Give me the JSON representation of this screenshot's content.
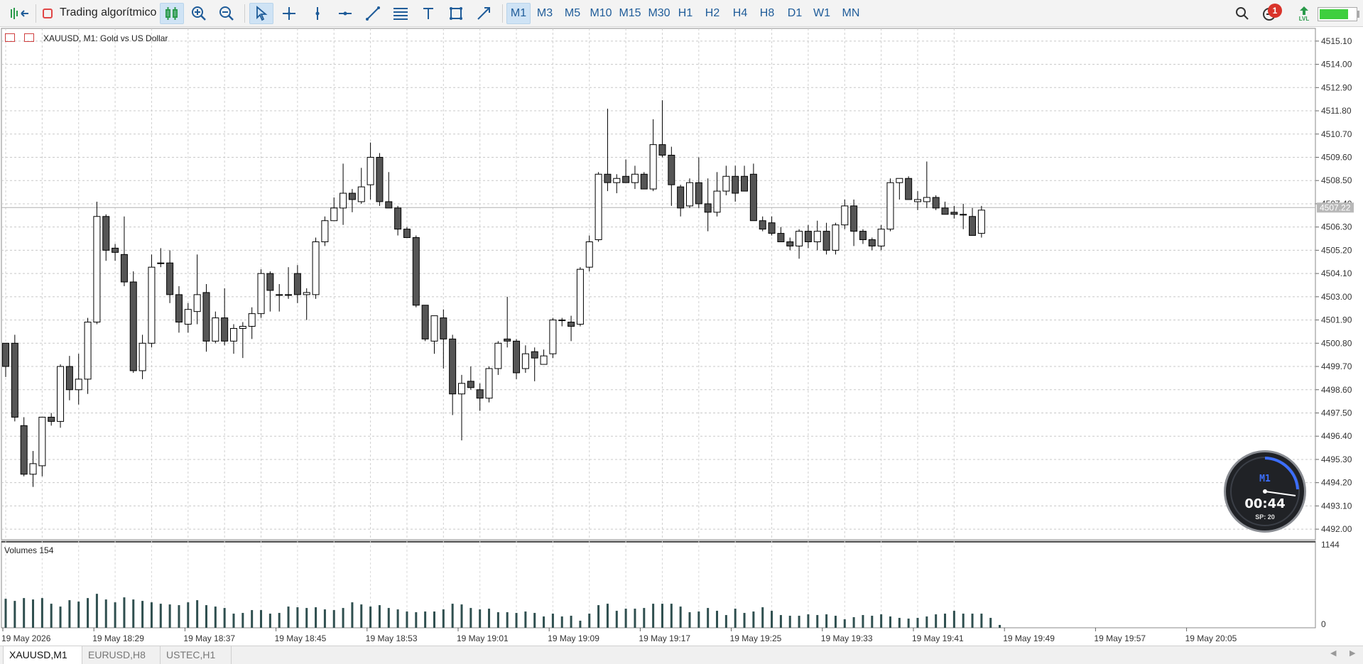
{
  "toolbar": {
    "algo_trading_label": "Trading algorítmico",
    "timeframes": [
      "M1",
      "M3",
      "M5",
      "M10",
      "M15",
      "M30",
      "H1",
      "H2",
      "H4",
      "H8",
      "D1",
      "W1",
      "MN"
    ],
    "active_timeframe": "M1",
    "notification_count": "1",
    "lvl_label": "LVL",
    "battery_level": 0.8
  },
  "chart": {
    "symbol_info": "XAUUSD, M1:  Gold vs US Dollar",
    "current_price_label": "4507.22",
    "price_labels": [
      "4515.10",
      "4514.00",
      "4512.90",
      "4511.80",
      "4510.70",
      "4509.60",
      "4508.50",
      "4507.40",
      "4506.30",
      "4505.20",
      "4504.10",
      "4503.00",
      "4501.90",
      "4500.80",
      "4499.70",
      "4498.60",
      "4497.50",
      "4496.40",
      "4495.30",
      "4494.20",
      "4493.10",
      "4492.00"
    ],
    "volume_label": "Volumes 154",
    "volume_scale_top": "1144",
    "volume_scale_bottom": "0",
    "time_labels": [
      "19 May 2026",
      "19 May 18:29",
      "19 May 18:37",
      "19 May 18:45",
      "19 May 18:53",
      "19 May 19:01",
      "19 May 19:09",
      "19 May 19:17",
      "19 May 19:25",
      "19 May 19:33",
      "19 May 19:41",
      "19 May 19:49",
      "19 May 19:57",
      "19 May 20:05"
    ]
  },
  "chart_data": {
    "type": "candlestick",
    "title": "XAUUSD, M1:  Gold vs US Dollar",
    "ylim": [
      4491.5,
      4515.7
    ],
    "candles": [
      [
        4500.8,
        4500.8,
        4499.2,
        4499.7
      ],
      [
        4500.8,
        4501.2,
        4497.1,
        4497.3
      ],
      [
        4496.9,
        4497.3,
        4494.5,
        4494.6
      ],
      [
        4494.6,
        4495.7,
        4494.0,
        4495.1
      ],
      [
        4495.0,
        4497.3,
        4494.5,
        4497.3
      ],
      [
        4497.3,
        4497.5,
        4496.9,
        4497.1
      ],
      [
        4497.1,
        4499.8,
        4496.8,
        4499.7
      ],
      [
        4499.7,
        4500.2,
        4498.1,
        4498.6
      ],
      [
        4498.6,
        4500.3,
        4497.9,
        4499.1
      ],
      [
        4499.1,
        4502.0,
        4498.4,
        4501.8
      ],
      [
        4501.8,
        4507.5,
        4501.7,
        4506.8
      ],
      [
        4506.8,
        4506.9,
        4504.7,
        4505.2
      ],
      [
        4505.3,
        4505.5,
        4504.7,
        4505.1
      ],
      [
        4505.0,
        4506.8,
        4503.5,
        4503.7
      ],
      [
        4503.7,
        4504.2,
        4499.4,
        4499.5
      ],
      [
        4499.5,
        4501.2,
        4499.1,
        4500.8
      ],
      [
        4500.8,
        4505.0,
        4500.6,
        4504.4
      ],
      [
        4504.6,
        4505.3,
        4504.4,
        4504.6
      ],
      [
        4504.6,
        4505.2,
        4502.7,
        4503.1
      ],
      [
        4503.1,
        4503.5,
        4501.3,
        4501.8
      ],
      [
        4501.7,
        4502.7,
        4501.3,
        4502.4
      ],
      [
        4502.3,
        4505.0,
        4501.7,
        4503.1
      ],
      [
        4503.2,
        4503.6,
        4500.4,
        4500.9
      ],
      [
        4500.9,
        4502.3,
        4500.8,
        4502.0
      ],
      [
        4502.0,
        4503.4,
        4500.7,
        4500.9
      ],
      [
        4500.9,
        4501.7,
        4500.3,
        4501.5
      ],
      [
        4501.5,
        4501.8,
        4500.1,
        4501.6
      ],
      [
        4501.6,
        4502.5,
        4501.0,
        4502.2
      ],
      [
        4502.2,
        4504.3,
        4502.0,
        4504.1
      ],
      [
        4504.1,
        4504.2,
        4502.3,
        4503.3
      ],
      [
        4503.1,
        4503.6,
        4502.3,
        4503.1
      ],
      [
        4503.1,
        4504.4,
        4502.9,
        4503.1
      ],
      [
        4504.1,
        4504.5,
        4502.7,
        4503.1
      ],
      [
        4503.1,
        4503.4,
        4501.9,
        4503.2
      ],
      [
        4503.1,
        4505.8,
        4502.9,
        4505.6
      ],
      [
        4505.6,
        4506.8,
        4505.4,
        4506.6
      ],
      [
        4506.6,
        4507.7,
        4506.6,
        4507.2
      ],
      [
        4507.2,
        4509.3,
        4506.4,
        4507.9
      ],
      [
        4507.9,
        4508.1,
        4507.0,
        4507.6
      ],
      [
        4507.5,
        4509.1,
        4507.4,
        4508.2
      ],
      [
        4508.3,
        4510.3,
        4507.6,
        4509.6
      ],
      [
        4509.6,
        4509.8,
        4507.3,
        4507.5
      ],
      [
        4507.5,
        4508.9,
        4507.2,
        4507.2
      ],
      [
        4507.2,
        4507.3,
        4505.9,
        4506.2
      ],
      [
        4506.2,
        4506.3,
        4505.8,
        4505.8
      ],
      [
        4505.8,
        4505.9,
        4502.5,
        4502.6
      ],
      [
        4502.6,
        4502.6,
        4500.9,
        4501.0
      ],
      [
        4500.9,
        4502.0,
        4500.3,
        4502.1
      ],
      [
        4502.0,
        4502.4,
        4499.6,
        4501.0
      ],
      [
        4501.0,
        4501.2,
        4497.4,
        4498.4
      ],
      [
        4498.4,
        4499.3,
        4496.2,
        4498.9
      ],
      [
        4499.0,
        4499.7,
        4498.6,
        4498.7
      ],
      [
        4498.6,
        4498.9,
        4497.6,
        4498.2
      ],
      [
        4498.2,
        4499.7,
        4498.0,
        4499.6
      ],
      [
        4499.6,
        4500.9,
        4499.3,
        4500.8
      ],
      [
        4501.0,
        4503.0,
        4500.6,
        4500.9
      ],
      [
        4500.9,
        4501.0,
        4499.1,
        4499.4
      ],
      [
        4499.6,
        4500.7,
        4499.4,
        4500.3
      ],
      [
        4500.4,
        4500.6,
        4499.0,
        4500.1
      ],
      [
        4499.8,
        4500.5,
        4499.8,
        4500.2
      ],
      [
        4500.3,
        4502.0,
        4500.1,
        4501.9
      ],
      [
        4501.9,
        4502.0,
        4501.6,
        4501.9
      ],
      [
        4501.8,
        4502.1,
        4500.9,
        4501.6
      ],
      [
        4501.7,
        4504.4,
        4501.6,
        4504.3
      ],
      [
        4504.4,
        4505.9,
        4504.2,
        4505.6
      ],
      [
        4505.7,
        4508.9,
        4505.6,
        4508.8
      ],
      [
        4508.8,
        4511.9,
        4508.0,
        4508.4
      ],
      [
        4508.4,
        4508.8,
        4507.9,
        4508.6
      ],
      [
        4508.7,
        4509.5,
        4508.4,
        4508.4
      ],
      [
        4508.4,
        4509.2,
        4508.1,
        4508.8
      ],
      [
        4508.8,
        4508.9,
        4508.1,
        4508.1
      ],
      [
        4508.1,
        4511.4,
        4508.0,
        4510.2
      ],
      [
        4510.2,
        4512.3,
        4509.6,
        4509.7
      ],
      [
        4509.7,
        4510.1,
        4507.3,
        4508.3
      ],
      [
        4508.2,
        4508.3,
        4506.8,
        4507.2
      ],
      [
        4507.3,
        4508.6,
        4507.2,
        4508.4
      ],
      [
        4508.4,
        4509.6,
        4507.2,
        4507.4
      ],
      [
        4507.4,
        4508.6,
        4506.1,
        4507.0
      ],
      [
        4507.0,
        4508.9,
        4506.8,
        4508.0
      ],
      [
        4508.0,
        4509.2,
        4507.8,
        4508.7
      ],
      [
        4508.7,
        4509.2,
        4507.5,
        4507.9
      ],
      [
        4508.7,
        4509.2,
        4508.0,
        4508.0
      ],
      [
        4508.8,
        4509.3,
        4506.6,
        4506.6
      ],
      [
        4506.6,
        4506.8,
        4506.1,
        4506.2
      ],
      [
        4506.5,
        4506.8,
        4505.9,
        4506.0
      ],
      [
        4506.0,
        4506.3,
        4505.6,
        4505.6
      ],
      [
        4505.6,
        4505.8,
        4505.2,
        4505.4
      ],
      [
        4505.4,
        4506.2,
        4504.8,
        4506.1
      ],
      [
        4506.1,
        4506.4,
        4505.3,
        4505.6
      ],
      [
        4505.6,
        4506.6,
        4505.2,
        4506.1
      ],
      [
        4506.1,
        4506.5,
        4505.0,
        4505.2
      ],
      [
        4505.2,
        4506.5,
        4505.0,
        4506.4
      ],
      [
        4506.4,
        4507.6,
        4506.2,
        4507.3
      ],
      [
        4507.3,
        4507.6,
        4505.4,
        4506.1
      ],
      [
        4506.1,
        4506.2,
        4505.5,
        4505.7
      ],
      [
        4505.7,
        4505.8,
        4505.2,
        4505.4
      ],
      [
        4505.4,
        4506.4,
        4505.2,
        4506.2
      ],
      [
        4506.2,
        4508.6,
        4506.1,
        4508.4
      ],
      [
        4508.4,
        4508.6,
        4507.6,
        4508.6
      ],
      [
        4508.6,
        4508.7,
        4507.6,
        4507.6
      ],
      [
        4507.5,
        4508.0,
        4507.1,
        4507.6
      ],
      [
        4507.5,
        4509.4,
        4507.2,
        4507.7
      ],
      [
        4507.7,
        4507.8,
        4507.1,
        4507.2
      ],
      [
        4507.2,
        4507.5,
        4506.9,
        4506.9
      ],
      [
        4507.0,
        4507.3,
        4506.7,
        4506.9
      ],
      [
        4506.9,
        4507.4,
        4506.2,
        4506.9
      ],
      [
        4506.8,
        4507.2,
        4505.9,
        4505.9
      ],
      [
        4506.0,
        4507.3,
        4505.8,
        4507.1
      ]
    ],
    "volumes": [
      410,
      380,
      420,
      400,
      420,
      340,
      300,
      390,
      370,
      420,
      480,
      400,
      360,
      430,
      400,
      380,
      360,
      340,
      330,
      320,
      360,
      390,
      320,
      300,
      280,
      200,
      210,
      250,
      250,
      200,
      210,
      300,
      290,
      280,
      290,
      260,
      250,
      280,
      360,
      330,
      300,
      320,
      280,
      260,
      230,
      220,
      230,
      230,
      260,
      340,
      330,
      280,
      260,
      270,
      220,
      220,
      210,
      230,
      210,
      160,
      200,
      160,
      170,
      100,
      200,
      320,
      340,
      240,
      270,
      270,
      280,
      340,
      340,
      340,
      300,
      220,
      230,
      280,
      240,
      180,
      270,
      210,
      230,
      290,
      240,
      180,
      170,
      170,
      190,
      180,
      190,
      170,
      120,
      150,
      180,
      170,
      190,
      160,
      140,
      130,
      140,
      160,
      190,
      200,
      240,
      200,
      200,
      200,
      140,
      40
    ]
  }
}
